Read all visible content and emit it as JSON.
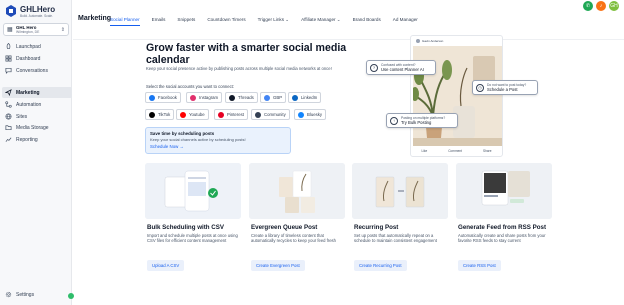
{
  "sidebar": {
    "logo_title": "GHLHero",
    "logo_sub": "Build. Automate. Scale.",
    "account_name": "GHL Hero",
    "account_location": "Wilmington, DE",
    "nav": [
      {
        "label": "Launchpad",
        "icon": "rocket-icon"
      },
      {
        "label": "Dashboard",
        "icon": "dashboard-icon"
      },
      {
        "label": "Conversations",
        "icon": "chat-icon"
      },
      {
        "label": "Marketing",
        "icon": "send-icon",
        "active": true
      },
      {
        "label": "Automation",
        "icon": "automation-icon"
      },
      {
        "label": "Sites",
        "icon": "globe-icon"
      },
      {
        "label": "Media Storage",
        "icon": "folder-icon"
      },
      {
        "label": "Reporting",
        "icon": "chart-icon"
      }
    ],
    "settings_label": "Settings"
  },
  "topbar": {
    "title": "Marketing",
    "tabs": [
      {
        "label": "Social Planner",
        "active": true
      },
      {
        "label": "Emails"
      },
      {
        "label": "Snippets"
      },
      {
        "label": "Countdown Timers"
      },
      {
        "label": "Trigger Links ⌄"
      },
      {
        "label": "Affiliate Manager ⌄"
      },
      {
        "label": "Brand Boards"
      },
      {
        "label": "Ad Manager"
      }
    ],
    "avatar_initials": "GH"
  },
  "hero": {
    "title": "Grow faster with a smarter social media calendar",
    "subtitle": "Keep your social presence active by publishing posts across multiple social media networks at once!",
    "connect_label": "Select the social accounts you want to connect:",
    "networks": [
      "Facebook",
      "Instagram",
      "Threads",
      "GBP",
      "LinkedIn",
      "TikTok",
      "Youtube",
      "Pinterest",
      "Community",
      "Bluesky"
    ],
    "info_title": "Save time by scheduling posts",
    "info_text": "Keep your social channels active by scheduling posts!",
    "info_link": "Schedule Now →"
  },
  "preview": {
    "handle": "Gavin Anderson",
    "stats": [
      "Like",
      "Comment",
      "Share"
    ],
    "callout1_q": "Confused with content?",
    "callout1_a": "Use content Planner AI",
    "callout2_q": "Do not want to post today?",
    "callout2_a": "Schedule a Post",
    "callout3_q": "Posting on multiple platforms?",
    "callout3_a": "Try Bulk Posting"
  },
  "cards": [
    {
      "title": "Bulk Scheduling with CSV",
      "desc": "Import and schedule multiple posts at once using CSV files for efficient content management",
      "button": "Upload A CSV"
    },
    {
      "title": "Evergreen Queue Post",
      "desc": "Create a library of timeless content that automatically recycles to keep your feed fresh",
      "button": "Create Evergreen Post"
    },
    {
      "title": "Recurring Post",
      "desc": "Set up posts that automatically repeat on a schedule to maintain consistent engagement",
      "button": "Create Recurring Post"
    },
    {
      "title": "Generate Feed from RSS Post",
      "desc": "Automatically create and share posts from your favorite RSS feeds to stay current",
      "button": "Create RSS Post"
    }
  ],
  "colors": {
    "accent": "#155eef",
    "active_nav": "#e4e7ec",
    "info_bg": "#eaf2fd"
  }
}
